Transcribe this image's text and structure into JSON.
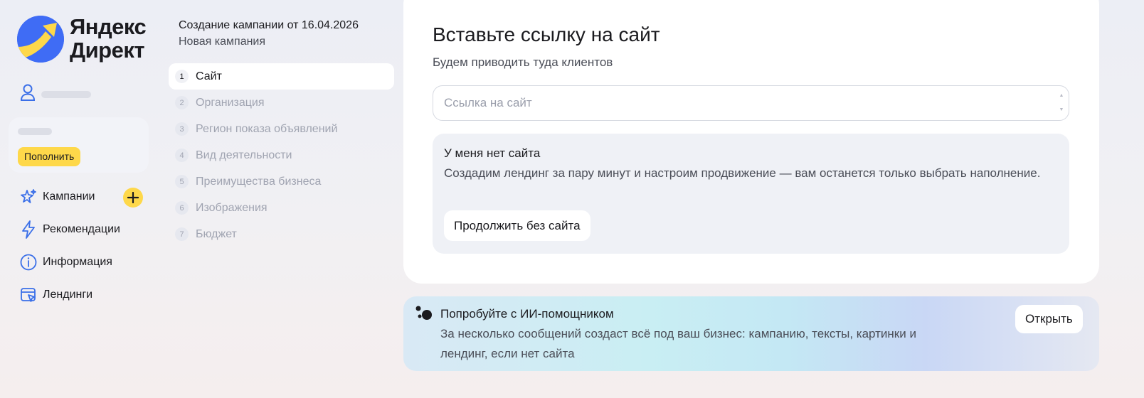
{
  "brand": {
    "line1": "Яндекс",
    "line2": "Директ"
  },
  "balance": {
    "topup_label": "Пополнить"
  },
  "nav": [
    {
      "label": "Кампании",
      "icon": "campaigns-sparkle-icon"
    },
    {
      "label": "Рекомендации",
      "icon": "lightning-icon"
    },
    {
      "label": "Информация",
      "icon": "info-icon"
    },
    {
      "label": "Лендинги",
      "icon": "landing-page-icon"
    }
  ],
  "campaign": {
    "title": "Создание кампании от 16.04.2026",
    "subtitle": "Новая кампания"
  },
  "steps": [
    {
      "num": "1",
      "label": "Сайт",
      "active": true
    },
    {
      "num": "2",
      "label": "Организация",
      "active": false
    },
    {
      "num": "3",
      "label": "Регион показа объявлений",
      "active": false
    },
    {
      "num": "4",
      "label": "Вид деятельности",
      "active": false
    },
    {
      "num": "5",
      "label": "Преимущества бизнеса",
      "active": false
    },
    {
      "num": "6",
      "label": "Изображения",
      "active": false
    },
    {
      "num": "7",
      "label": "Бюджет",
      "active": false
    }
  ],
  "site_form": {
    "title": "Вставьте ссылку на сайт",
    "subtitle": "Будем приводить туда клиентов",
    "input_placeholder": "Ссылка на сайт",
    "input_value": ""
  },
  "no_site": {
    "title": "У меня нет сайта",
    "text": "Создадим лендинг за пару минут и настроим продвижение — вам останется только выбрать наполнение.",
    "button_label": "Продолжить без сайта"
  },
  "ai_banner": {
    "title": "Попробуйте с ИИ-помощником",
    "text": "За несколько сообщений создаст всё под ваш бизнес: кампанию, тексты, картинки и лендинг, если нет сайта",
    "button_label": "Открыть"
  },
  "colors": {
    "accent_yellow": "#fed84a",
    "brand_blue": "#3f6cf5",
    "icon_blue": "#3a6fe8",
    "active_step_bg": "#ffffff",
    "muted_text": "#a0a4b1"
  }
}
